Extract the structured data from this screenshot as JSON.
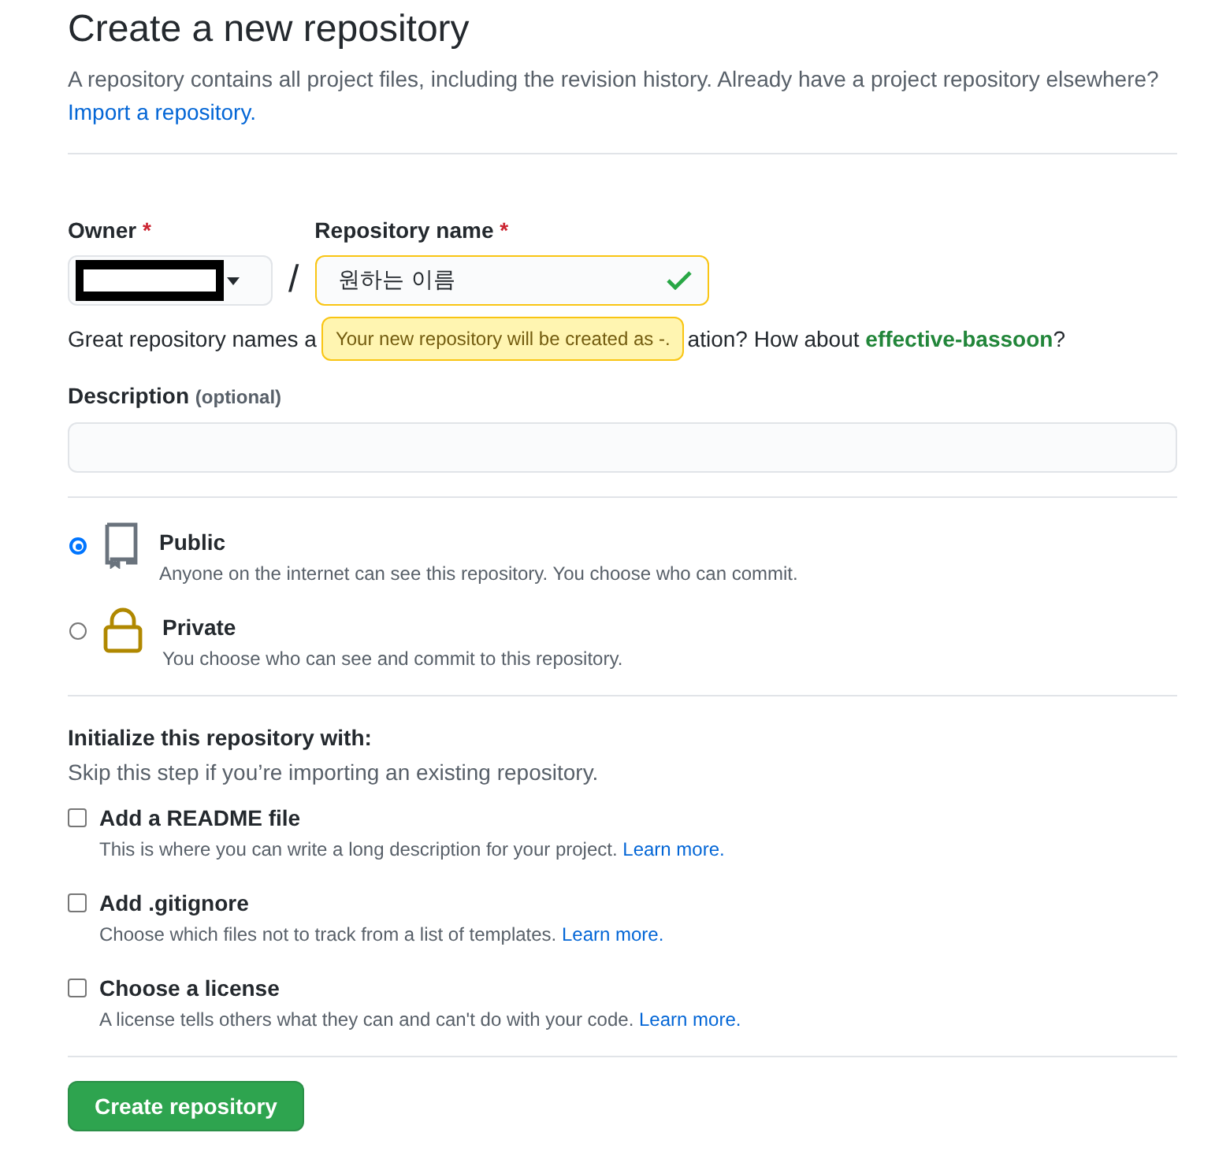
{
  "title": "Create a new repository",
  "subtitle": "A repository contains all project files, including the revision history. Already have a project repository elsewhere?",
  "import_link": "Import a repository.",
  "owner": {
    "label": "Owner",
    "required_mark": "*",
    "redacted": true
  },
  "separator": "/",
  "repository_name": {
    "label": "Repository name",
    "required_mark": "*",
    "value": "원하는 이름",
    "valid": true
  },
  "name_hint": {
    "before": "Great repository names a",
    "after": "ation? How about",
    "suggestion": "effective-bassoon",
    "end": "?"
  },
  "tooltip": "Your new repository will be created as -.",
  "description": {
    "label": "Description",
    "note": "(optional)"
  },
  "visibility": [
    {
      "kind": "book",
      "label": "Public",
      "text": "Anyone on the internet can see this repository. You choose who can commit.",
      "selected": true
    },
    {
      "kind": "lock",
      "label": "Private",
      "text": "You choose who can see and commit to this repository.",
      "selected": false
    }
  ],
  "init": {
    "heading": "Initialize this repository with:",
    "text": "Skip this step if you’re importing an existing repository."
  },
  "options": [
    {
      "label": "Add a README file",
      "text": "This is where you can write a long description for your project.",
      "link": "Learn more.",
      "checked": false
    },
    {
      "label": "Add .gitignore",
      "text": "Choose which files not to track from a list of templates.",
      "link": "Learn more.",
      "checked": false
    },
    {
      "label": "Choose a license",
      "text": "A license tells others what they can and can't do with your code.",
      "link": "Learn more.",
      "checked": false
    }
  ],
  "submit": "Create repository"
}
